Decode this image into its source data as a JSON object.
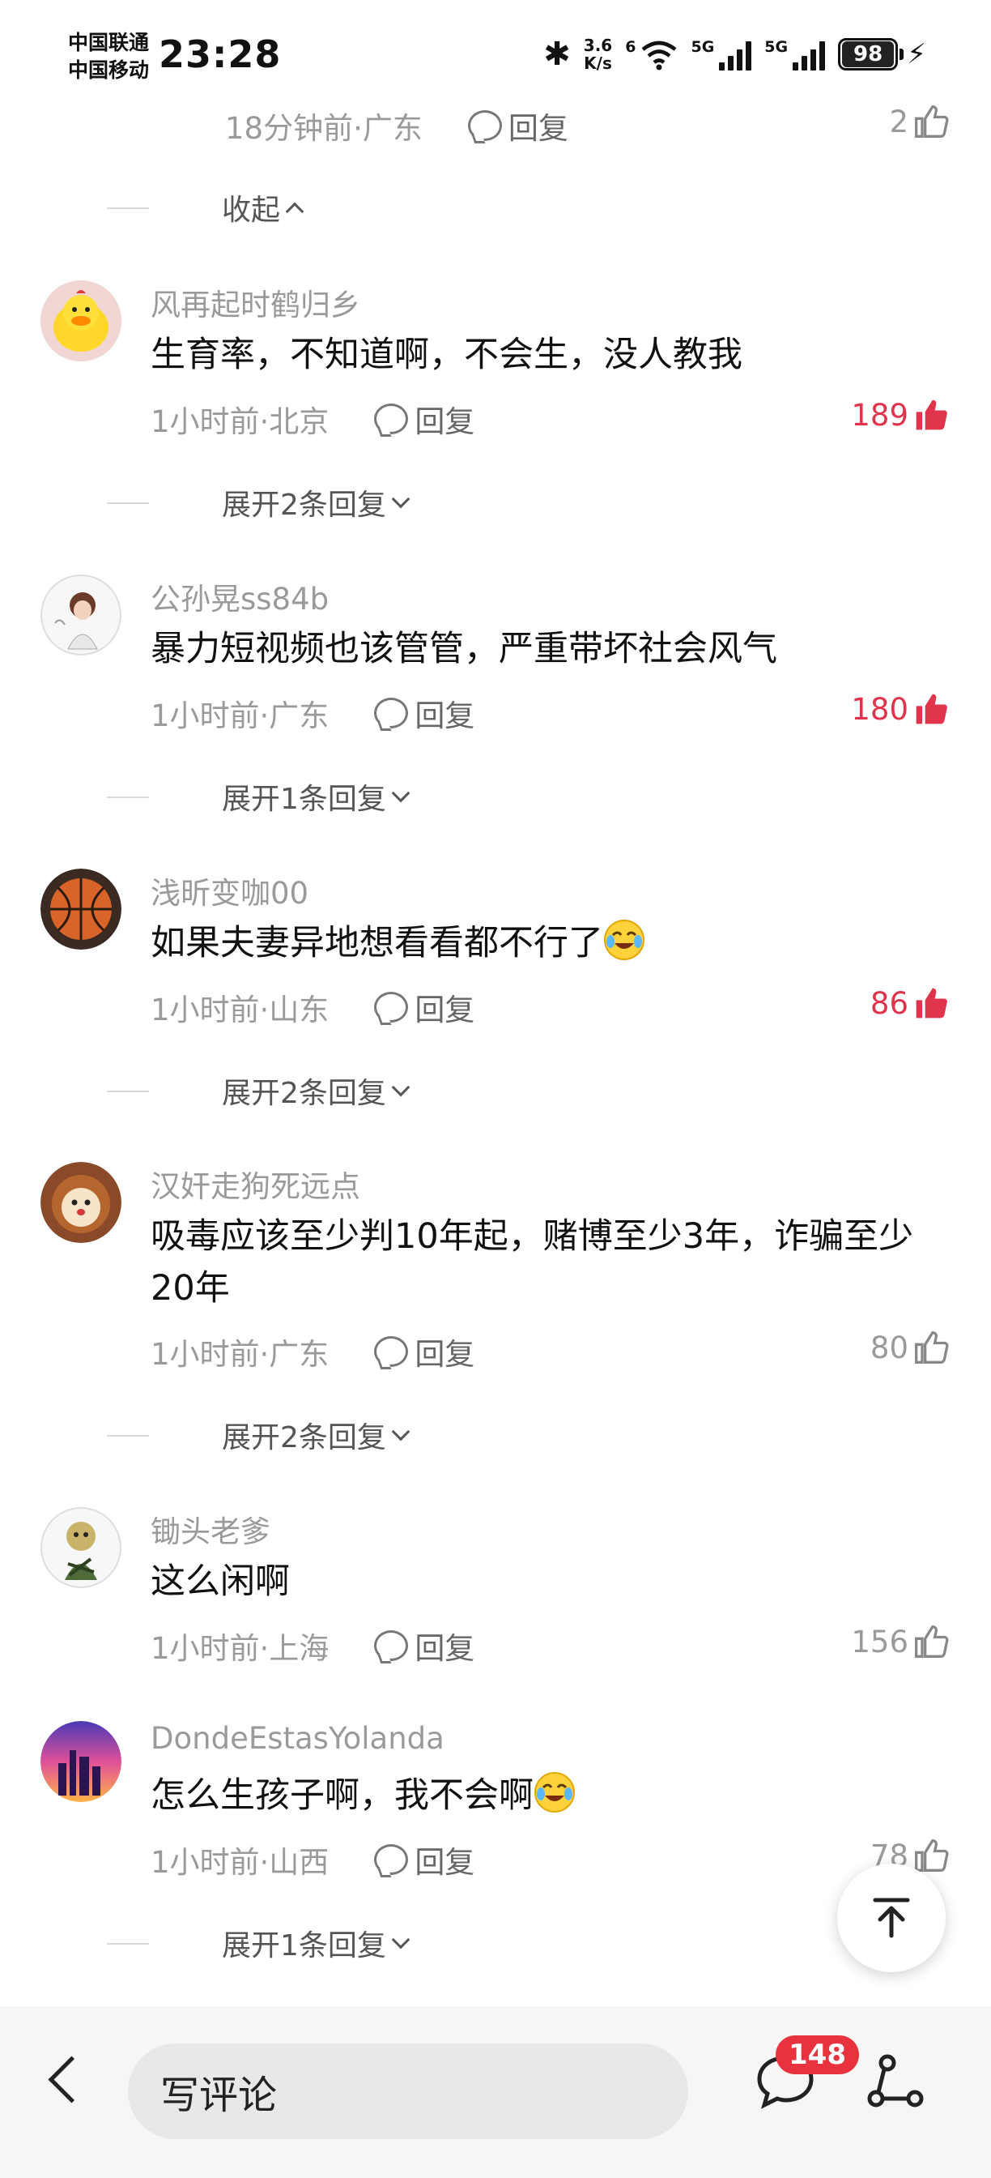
{
  "status_bar": {
    "carrier1": "中国联通",
    "carrier2": "中国移动",
    "time": "23:28",
    "net_speed_value": "3.6",
    "net_speed_unit": "K/s",
    "wifi_gen": "6",
    "sig1_gen": "5G",
    "sig2_gen": "5G",
    "battery": "98"
  },
  "top_partial": {
    "meta": "18分钟前·广东",
    "reply": "回复",
    "likes": "2",
    "collapse": "收起"
  },
  "comments": [
    {
      "username": "风再起时鹤归乡",
      "text": "生育率，不知道啊，不会生，没人教我",
      "meta": "1小时前·北京",
      "reply": "回复",
      "likes": "189",
      "hot": true,
      "expand": "展开2条回复"
    },
    {
      "username": "公孙晃ss84b",
      "text": "暴力短视频也该管管，严重带坏社会风气",
      "meta": "1小时前·广东",
      "reply": "回复",
      "likes": "180",
      "hot": true,
      "expand": "展开1条回复"
    },
    {
      "username": "浅昕变咖00",
      "text": "如果夫妻异地想看看都不行了",
      "meta": "1小时前·山东",
      "reply": "回复",
      "likes": "86",
      "hot": true,
      "expand": "展开2条回复"
    },
    {
      "username": "汉奸走狗死远点",
      "text": "吸毒应该至少判10年起，赌博至少3年，诈骗至少20年",
      "meta": "1小时前·广东",
      "reply": "回复",
      "likes": "80",
      "hot": false,
      "expand": "展开2条回复"
    },
    {
      "username": "锄头老爹",
      "text": "这么闲啊",
      "meta": "1小时前·上海",
      "reply": "回复",
      "likes": "156",
      "hot": false,
      "expand": ""
    },
    {
      "username": "DondeEstasYolanda",
      "text": "怎么生孩子啊，我不会啊",
      "meta": "1小时前·山西",
      "reply": "回复",
      "likes": "78",
      "hot": false,
      "expand": "展开1条回复"
    }
  ],
  "bottom_bar": {
    "input_placeholder": "写评论",
    "comment_count": "148"
  },
  "colors": {
    "hot_like": "#e0334c",
    "badge": "#e8333e",
    "muted": "#9a9a9a"
  },
  "icons": [
    "bluetooth-icon",
    "wifi-icon",
    "signal-icon",
    "battery-icon",
    "comment-bubble-icon",
    "thumb-up-icon",
    "chevron-down-icon",
    "chevron-up-icon",
    "back-icon",
    "chat-icon",
    "share-icon",
    "arrow-to-top-icon"
  ]
}
